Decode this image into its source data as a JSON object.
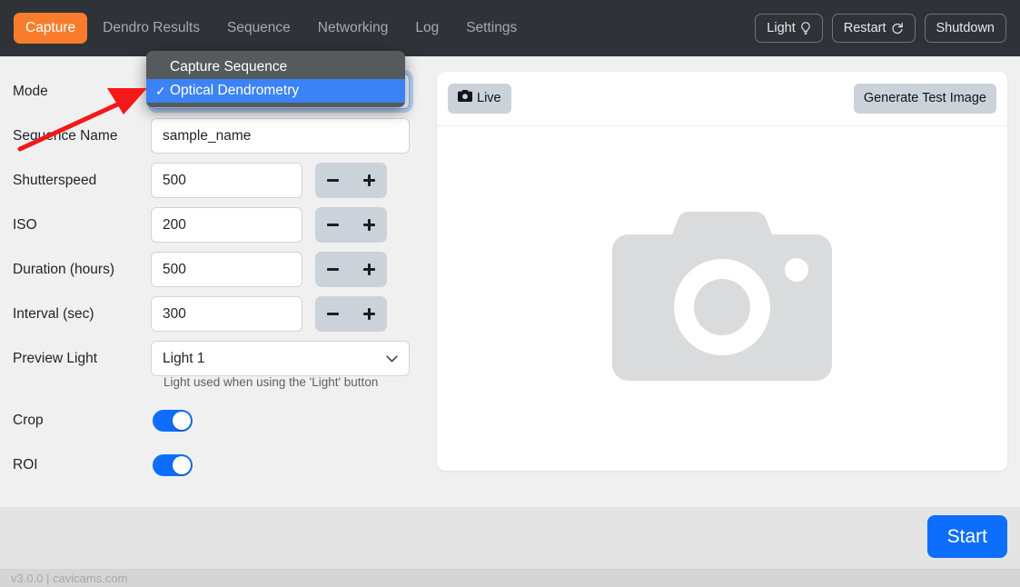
{
  "navbar": {
    "tabs": [
      {
        "label": "Capture",
        "active": true
      },
      {
        "label": "Dendro Results",
        "active": false
      },
      {
        "label": "Sequence",
        "active": false
      },
      {
        "label": "Networking",
        "active": false
      },
      {
        "label": "Log",
        "active": false
      },
      {
        "label": "Settings",
        "active": false
      }
    ],
    "buttons": [
      {
        "label": "Light",
        "icon": "lightbulb-icon"
      },
      {
        "label": "Restart",
        "icon": "restart-icon"
      },
      {
        "label": "Shutdown",
        "icon": null
      }
    ],
    "active_accent": "#f97c2c",
    "background": "#2f3337"
  },
  "form": {
    "mode": {
      "label": "Mode",
      "value": "Optical Dendrometry",
      "focused": true,
      "options": [
        "Capture Sequence",
        "Optical Dendrometry"
      ]
    },
    "sequence_name": {
      "label": "Sequence Name",
      "value": "sample_name",
      "placeholder": "sample_name"
    },
    "shutterspeed": {
      "label": "Shutterspeed",
      "value": "500"
    },
    "iso": {
      "label": "ISO",
      "value": "200"
    },
    "duration": {
      "label": "Duration (hours)",
      "value": "500"
    },
    "interval": {
      "label": "Interval (sec)",
      "value": "300"
    },
    "preview_light": {
      "label": "Preview Light",
      "value": "Light 1",
      "help": "Light used when using the 'Light' button",
      "options": [
        "Light 1"
      ]
    },
    "crop": {
      "label": "Crop",
      "on": true
    },
    "roi": {
      "label": "ROI",
      "on": true
    },
    "stepper": {
      "minus": "−",
      "plus": "+"
    }
  },
  "dropdown_popup": {
    "items": [
      {
        "label": "Capture Sequence",
        "selected": false,
        "check": ""
      },
      {
        "label": "Optical Dendrometry",
        "selected": true,
        "check": "✓"
      }
    ]
  },
  "preview": {
    "live_button": {
      "label": "Live",
      "icon": "camera-icon"
    },
    "generate_button": {
      "label": "Generate Test Image"
    },
    "placeholder_icon": "camera-placeholder-icon"
  },
  "actions": {
    "start_label": "Start",
    "start_color": "#0d6efd"
  },
  "footer": {
    "text": "v3.0.0 | cavicams.com"
  },
  "annotation": {
    "type": "red-arrow",
    "color": "#f41818"
  }
}
